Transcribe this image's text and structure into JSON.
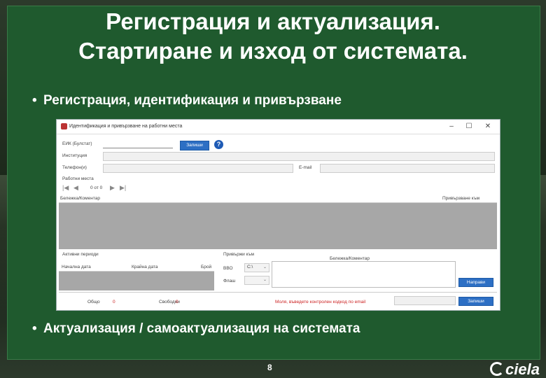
{
  "slide": {
    "title_line1": "Регистрация и актуализация.",
    "title_line2": "Стартиране и изход от системата.",
    "bullet1": "Регистрация, идентификация и привързване",
    "bullet2": "Актуализация / самоактуализация на системата",
    "bullet_symbol": "•",
    "page_number": "8",
    "logo_text": "ciela"
  },
  "window": {
    "title": "Идентификация и привързване на работни места",
    "controls": {
      "minimize": "–",
      "maximize": "☐",
      "close": "✕"
    },
    "eik_label": "ЕИК (Булстат)",
    "register_button": "Запиши",
    "help_symbol": "?",
    "institution_label": "Институция",
    "phone_label": "Телефон(и)",
    "email_label": "E-mail",
    "workplaces_label": "Работни места",
    "pager_text": "0 от 0",
    "grid_note_header": "Бележка/Коментар",
    "grid_bind_header": "Привързване към",
    "active_periods_label": "Активни периоди",
    "period_start_header": "Начална дата",
    "period_end_header": "Крайна дата",
    "period_count_header": "Брой",
    "bind_to_label": "Привържи към",
    "note_label": "Бележка/Коментар",
    "row1_label": "ВВО",
    "row1_value": "С:\\",
    "row2_label": "Флаш",
    "row2_value": "",
    "bind_button": "Направи",
    "bind_button_2": "Направи",
    "total_label": "Общо",
    "total_value": "0",
    "free_label": "Свободни",
    "free_value": "0",
    "control_code_message": "Моля, въведете контролен кодкод по email",
    "save_button": "Запиши"
  },
  "colors": {
    "panel_green": "#1f5a2e",
    "button_blue": "#2d6fc4",
    "warning_red": "#cc2222",
    "grid_gray": "#a7a7a7"
  }
}
